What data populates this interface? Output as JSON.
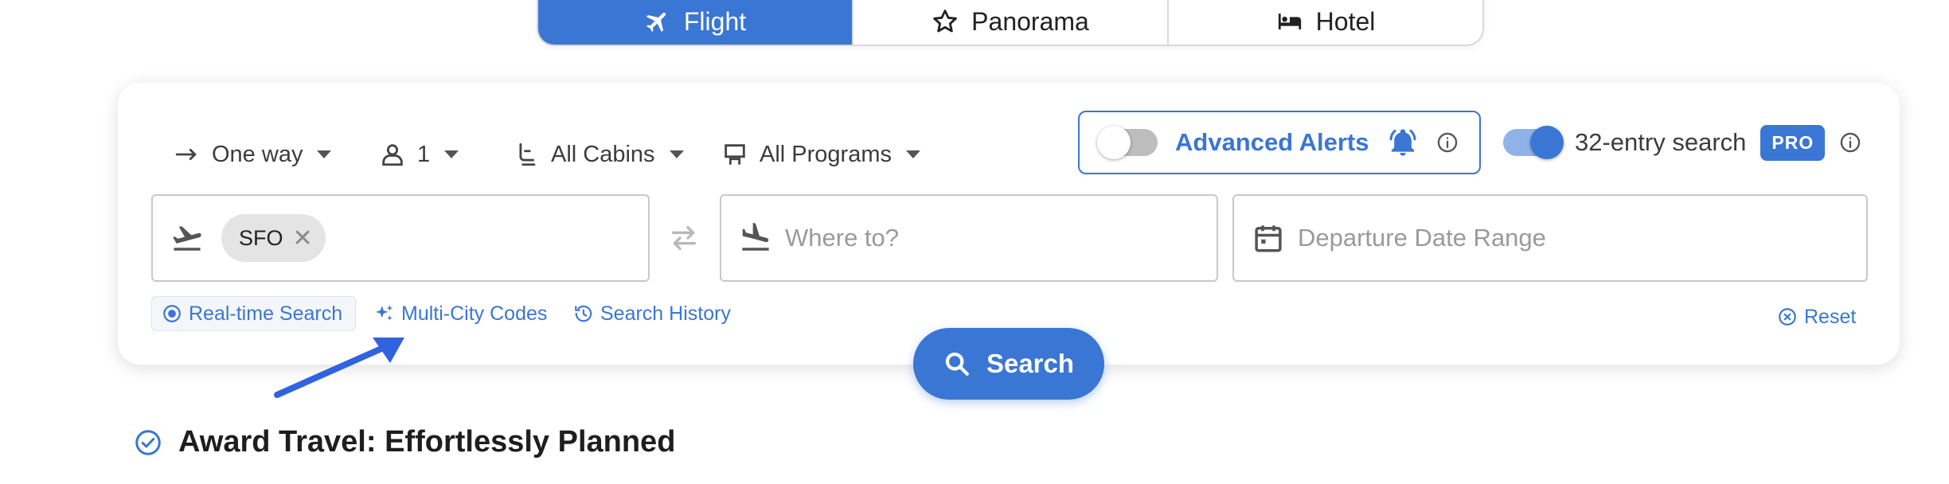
{
  "tabs": [
    {
      "label": "Flight",
      "icon": "airplane-icon",
      "active": true
    },
    {
      "label": "Panorama",
      "icon": "star-icon",
      "active": false
    },
    {
      "label": "Hotel",
      "icon": "bed-icon",
      "active": false
    }
  ],
  "options": {
    "trip_type": "One way",
    "passengers": "1",
    "cabin": "All Cabins",
    "programs": "All Programs"
  },
  "alerts": {
    "label": "Advanced Alerts",
    "enabled": false
  },
  "entry_search": {
    "label": "32-entry search",
    "badge": "PRO",
    "enabled": true
  },
  "fields": {
    "origin_chip": "SFO",
    "destination_placeholder": "Where to?",
    "date_placeholder": "Departure Date Range"
  },
  "links": {
    "realtime": "Real-time Search",
    "multicity": "Multi-City Codes",
    "history": "Search History",
    "reset": "Reset"
  },
  "search_button": "Search",
  "tagline": "Award Travel: Effortlessly Planned",
  "colors": {
    "accent": "#3a76d3",
    "annotation_arrow": "#2f63e0"
  }
}
